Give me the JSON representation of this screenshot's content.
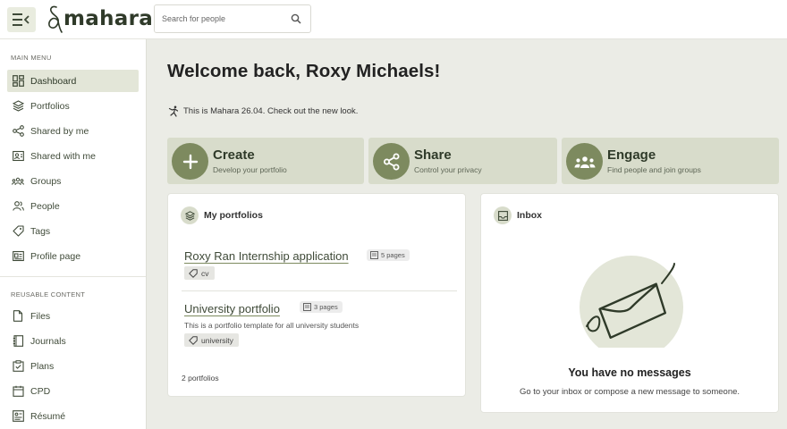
{
  "header": {
    "logo_text": "mahara",
    "search_placeholder": "Search for people"
  },
  "sidebar": {
    "main_menu_label": "MAIN MENU",
    "main_items": [
      {
        "label": "Dashboard",
        "icon": "dashboard-icon",
        "active": true
      },
      {
        "label": "Portfolios",
        "icon": "layers-icon"
      },
      {
        "label": "Shared by me",
        "icon": "share-icon"
      },
      {
        "label": "Shared with me",
        "icon": "shared-with-me-icon"
      },
      {
        "label": "Groups",
        "icon": "groups-icon"
      },
      {
        "label": "People",
        "icon": "people-icon"
      },
      {
        "label": "Tags",
        "icon": "tag-icon"
      },
      {
        "label": "Profile page",
        "icon": "profile-card-icon"
      }
    ],
    "reusable_label": "REUSABLE CONTENT",
    "reusable_items": [
      {
        "label": "Files",
        "icon": "file-icon"
      },
      {
        "label": "Journals",
        "icon": "journal-icon"
      },
      {
        "label": "Plans",
        "icon": "plans-icon"
      },
      {
        "label": "CPD",
        "icon": "cpd-icon"
      },
      {
        "label": "Résumé",
        "icon": "resume-icon"
      }
    ]
  },
  "main": {
    "title": "Welcome back, Roxy Michaels!",
    "notice": "This is Mahara 26.04. Check out the new look.",
    "actions": [
      {
        "title": "Create",
        "subtitle": "Develop your portfolio",
        "icon": "plus-icon"
      },
      {
        "title": "Share",
        "subtitle": "Control your privacy",
        "icon": "share-icon"
      },
      {
        "title": "Engage",
        "subtitle": "Find people and join groups",
        "icon": "groups-icon"
      }
    ],
    "portfolios": {
      "heading": "My portfolios",
      "items": [
        {
          "title": "Roxy Ran Internship application",
          "pages": "5 pages",
          "description": "",
          "tag": "cv"
        },
        {
          "title": "University portfolio",
          "pages": "3 pages",
          "description": "This is a portfolio template for all university students",
          "tag": "university"
        }
      ],
      "count": "2 portfolios"
    },
    "inbox": {
      "heading": "Inbox",
      "empty_title": "You have no messages",
      "empty_text": "Go to your inbox or compose a new message to someone."
    }
  },
  "colors": {
    "accent": "#7d8a5f",
    "active_bg": "#e3e6d8",
    "action_bg": "#d8dccb",
    "page_bg": "#ebece6"
  }
}
